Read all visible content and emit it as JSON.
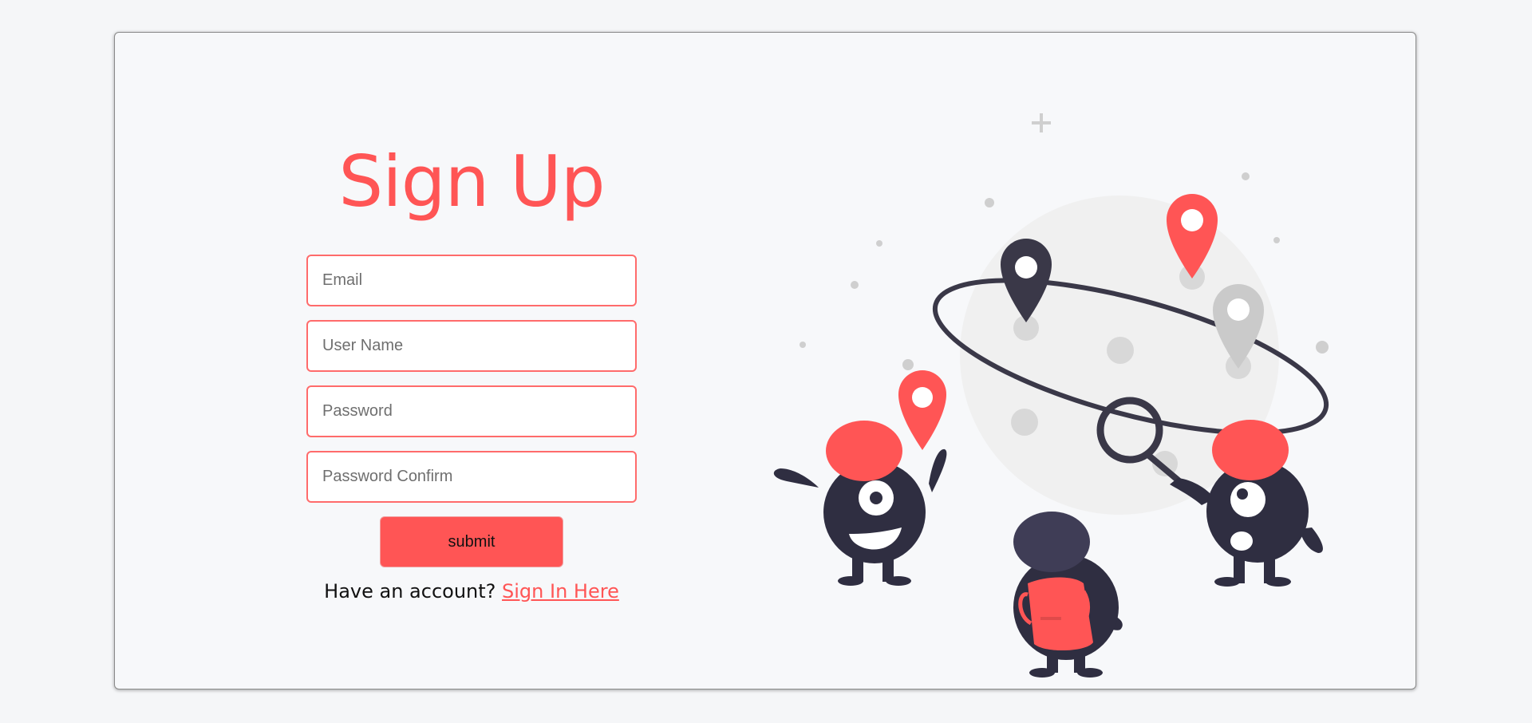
{
  "form": {
    "title": "Sign Up",
    "email_placeholder": "Email",
    "username_placeholder": "User Name",
    "password_placeholder": "Password",
    "password_confirm_placeholder": "Password Confirm",
    "submit_label": "submit",
    "account_prompt": "Have an account?",
    "signin_link": "Sign In Here"
  },
  "colors": {
    "accent": "#ff5555",
    "dark": "#2f2e41",
    "planet": "#f0f0f0",
    "gray_pin": "#cacaca"
  }
}
